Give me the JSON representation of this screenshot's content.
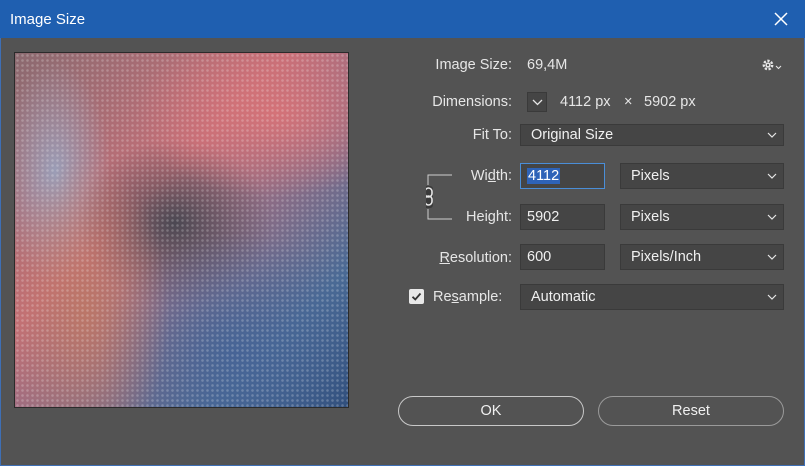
{
  "window": {
    "title": "Image Size"
  },
  "image_size": {
    "label": "Image Size:",
    "value": "69,4M"
  },
  "dimensions": {
    "label": "Dimensions:",
    "width": "4112 px",
    "times": "×",
    "height": "5902 px"
  },
  "fit_to": {
    "label": "Fit To:",
    "value": "Original Size"
  },
  "width": {
    "label_pre": "Wi",
    "label_u": "d",
    "label_post": "th:",
    "value": "4112",
    "unit": "Pixels"
  },
  "height": {
    "label_pre": "Hei",
    "label_u": "g",
    "label_post": "ht:",
    "value": "5902",
    "unit": "Pixels"
  },
  "resolution": {
    "label_pre": "",
    "label_u": "R",
    "label_post": "esolution:",
    "value": "600",
    "unit": "Pixels/Inch"
  },
  "resample": {
    "label_pre": "Re",
    "label_u": "s",
    "label_post": "ample:",
    "checked": true,
    "value": "Automatic"
  },
  "buttons": {
    "ok": "OK",
    "reset": "Reset"
  },
  "icons": {
    "close": "close-icon",
    "gear": "gear-icon",
    "chevron": "chevron-down-icon",
    "link": "link-icon",
    "check": "checkmark-icon"
  },
  "colors": {
    "titlebar": "#1f5fb0",
    "background": "#535353",
    "field": "#454545",
    "selection": "#2e63b8"
  }
}
